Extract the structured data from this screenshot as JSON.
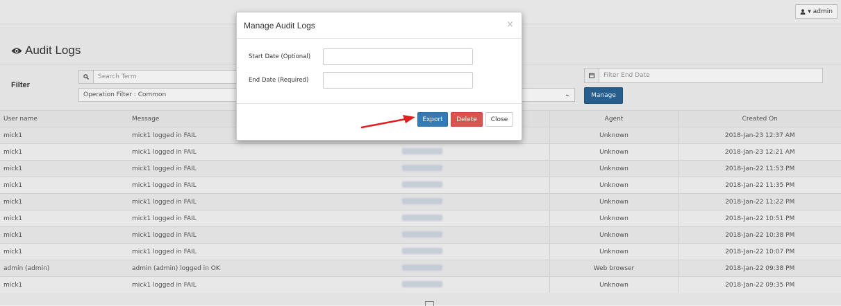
{
  "header": {
    "admin_label": "admin",
    "admin_icon": "user-icon"
  },
  "page": {
    "title": "Audit Logs",
    "title_icon": "eye-icon"
  },
  "filter": {
    "label": "Filter",
    "search_placeholder": "Search Term",
    "operation_filter": "Operation Filter : Common",
    "end_date_placeholder": "Filter End Date",
    "manage_label": "Manage"
  },
  "table": {
    "columns": [
      "User name",
      "Message",
      "",
      "Agent",
      "Created On"
    ],
    "rows": [
      {
        "user": "mick1",
        "message": "mick1 logged in FAIL",
        "agent": "Unknown",
        "created": "2018-Jan-23 12:37 AM"
      },
      {
        "user": "mick1",
        "message": "mick1 logged in FAIL",
        "agent": "Unknown",
        "created": "2018-Jan-23 12:21 AM"
      },
      {
        "user": "mick1",
        "message": "mick1 logged in FAIL",
        "agent": "Unknown",
        "created": "2018-Jan-22 11:53 PM"
      },
      {
        "user": "mick1",
        "message": "mick1 logged in FAIL",
        "agent": "Unknown",
        "created": "2018-Jan-22 11:35 PM"
      },
      {
        "user": "mick1",
        "message": "mick1 logged in FAIL",
        "agent": "Unknown",
        "created": "2018-Jan-22 11:22 PM"
      },
      {
        "user": "mick1",
        "message": "mick1 logged in FAIL",
        "agent": "Unknown",
        "created": "2018-Jan-22 10:51 PM"
      },
      {
        "user": "mick1",
        "message": "mick1 logged in FAIL",
        "agent": "Unknown",
        "created": "2018-Jan-22 10:38 PM"
      },
      {
        "user": "mick1",
        "message": "mick1 logged in FAIL",
        "agent": "Unknown",
        "created": "2018-Jan-22 10:07 PM"
      },
      {
        "user": "admin (admin)",
        "message": "admin (admin) logged in OK",
        "agent": "Web browser",
        "created": "2018-Jan-22 09:38 PM"
      },
      {
        "user": "mick1",
        "message": "mick1 logged in FAIL",
        "agent": "Unknown",
        "created": "2018-Jan-22 09:35 PM"
      }
    ]
  },
  "modal": {
    "title": "Manage Audit Logs",
    "close_symbol": "×",
    "start_label": "Start Date (Optional)",
    "end_label": "End Date (Required)",
    "export_label": "Export",
    "delete_label": "Delete",
    "close_label": "Close"
  },
  "colors": {
    "primary": "#337ab7",
    "danger": "#d9534f",
    "arrow": "#e02020"
  }
}
